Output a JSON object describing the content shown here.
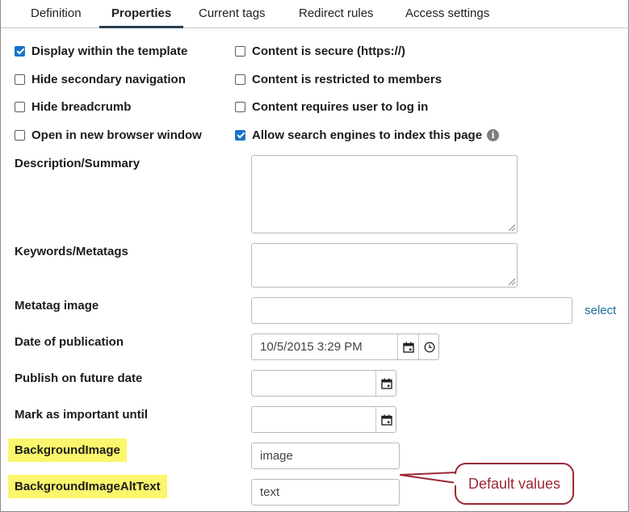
{
  "tabs": [
    {
      "label": "Definition",
      "active": false
    },
    {
      "label": "Properties",
      "active": true
    },
    {
      "label": "Current tags",
      "active": false
    },
    {
      "label": "Redirect rules",
      "active": false
    },
    {
      "label": "Access settings",
      "active": false
    }
  ],
  "checkboxes": {
    "display_within_template": {
      "label": "Display within the template",
      "checked": true
    },
    "hide_secondary_navigation": {
      "label": "Hide secondary navigation",
      "checked": false
    },
    "hide_breadcrumb": {
      "label": "Hide breadcrumb",
      "checked": false
    },
    "open_in_new_window": {
      "label": "Open in new browser window",
      "checked": false
    },
    "content_is_secure": {
      "label": "Content is secure (https://)",
      "checked": false
    },
    "content_restricted": {
      "label": "Content is restricted to members",
      "checked": false
    },
    "content_requires_login": {
      "label": "Content requires user to log in",
      "checked": false
    },
    "allow_search_engines": {
      "label": "Allow search engines to index this page",
      "checked": true
    }
  },
  "fields": {
    "description": {
      "label": "Description/Summary",
      "value": ""
    },
    "keywords": {
      "label": "Keywords/Metatags",
      "value": ""
    },
    "metatag_image": {
      "label": "Metatag image",
      "value": "",
      "link": "select"
    },
    "date_of_publication": {
      "label": "Date of publication",
      "value": "10/5/2015 3:29 PM"
    },
    "publish_on_future_date": {
      "label": "Publish on future date",
      "value": ""
    },
    "mark_as_important_until": {
      "label": "Mark as important until",
      "value": ""
    },
    "background_image": {
      "label": "BackgroundImage",
      "value": "image"
    },
    "background_image_alt_text": {
      "label": "BackgroundImageAltText",
      "value": "text"
    }
  },
  "annotation": {
    "text": "Default values",
    "color": "#9b2734",
    "highlight_color": "#fbf66b"
  },
  "colors": {
    "checkbox_checked": "#1a73c8",
    "link": "#1d6f97",
    "active_tab_underline": "#2b3f4f"
  },
  "icons": {
    "calendar": "calendar-icon",
    "clock": "clock-icon",
    "info": "info-icon"
  }
}
